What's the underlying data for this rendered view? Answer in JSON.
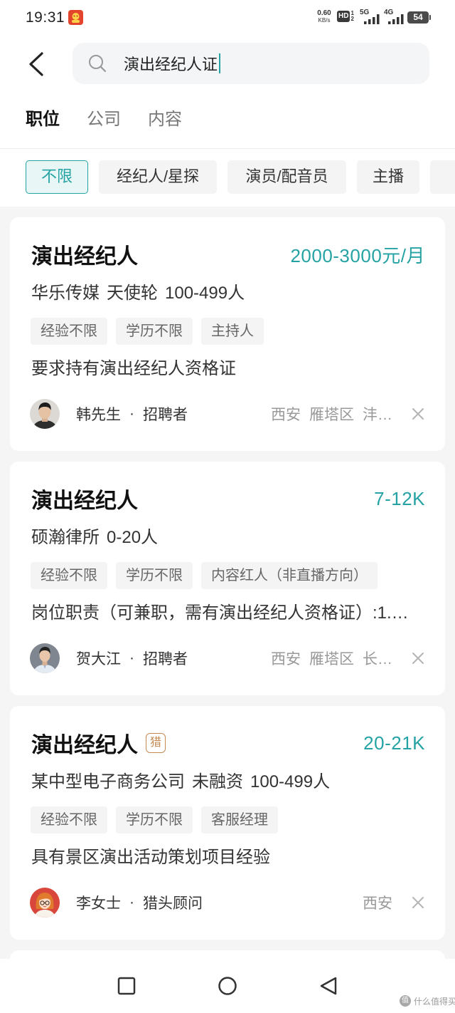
{
  "status_bar": {
    "time": "19:31",
    "net_speed": "0.60",
    "net_unit": "KB/s",
    "hd": "HD",
    "sim_top": "1",
    "sim_bottom": "2",
    "net_1": "5G",
    "net_2": "4G",
    "battery": "54"
  },
  "icons": {
    "status_app": "app-notification-icon",
    "back": "chevron-left-icon",
    "search": "search-icon",
    "dismiss": "close-icon",
    "nav_recent": "recent-apps-icon",
    "nav_home": "home-icon",
    "nav_back": "back-triangle-icon"
  },
  "search": {
    "query": "演出经纪人证"
  },
  "tabs": [
    {
      "label": "职位",
      "active": true
    },
    {
      "label": "公司",
      "active": false
    },
    {
      "label": "内容",
      "active": false
    }
  ],
  "filters": [
    {
      "label": "不限",
      "selected": true
    },
    {
      "label": "经纪人/星探",
      "selected": false
    },
    {
      "label": "演员/配音员",
      "selected": false
    },
    {
      "label": "主播",
      "selected": false
    }
  ],
  "recruiter_separator": "·",
  "jobs": [
    {
      "title": "演出经纪人",
      "salary": "2000-3000元/月",
      "company_info": [
        "华乐传媒",
        "天使轮",
        "100-499人"
      ],
      "tags": [
        "经验不限",
        "学历不限",
        "主持人"
      ],
      "description": "要求持有演出经纪人资格证",
      "recruiter": {
        "name": "韩先生",
        "role": "招聘者"
      },
      "location": [
        "西安",
        "雁塔区",
        "沣…"
      ]
    },
    {
      "title": "演出经纪人",
      "salary": "7-12K",
      "company_info": [
        "硕瀚律所",
        "0-20人"
      ],
      "tags": [
        "经验不限",
        "学历不限",
        "内容红人（非直播方向）"
      ],
      "description": "岗位职责（可兼职，需有演出经纪人资格证）:1.…",
      "recruiter": {
        "name": "贺大江",
        "role": "招聘者"
      },
      "location": [
        "西安",
        "雁塔区",
        "长…"
      ]
    },
    {
      "title": "演出经纪人",
      "badge": "猎",
      "salary": "20-21K",
      "company_info": [
        "某中型电子商务公司",
        "未融资",
        "100-499人"
      ],
      "tags": [
        "经验不限",
        "学历不限",
        "客服经理"
      ],
      "description": "具有景区演出活动策划项目经验",
      "recruiter": {
        "name": "李女士",
        "role": "猎头顾问"
      },
      "location": [
        "西安"
      ]
    }
  ],
  "colors": {
    "accent": "#25a3a4",
    "accent_light_bg": "#e8f7f6",
    "page_bg": "#f5f5f5",
    "card_bg": "#ffffff",
    "tag_bg": "#f4f4f4",
    "hunter_badge": "#c58a52"
  },
  "watermark": {
    "logo": "值",
    "text": "什么值得买"
  }
}
